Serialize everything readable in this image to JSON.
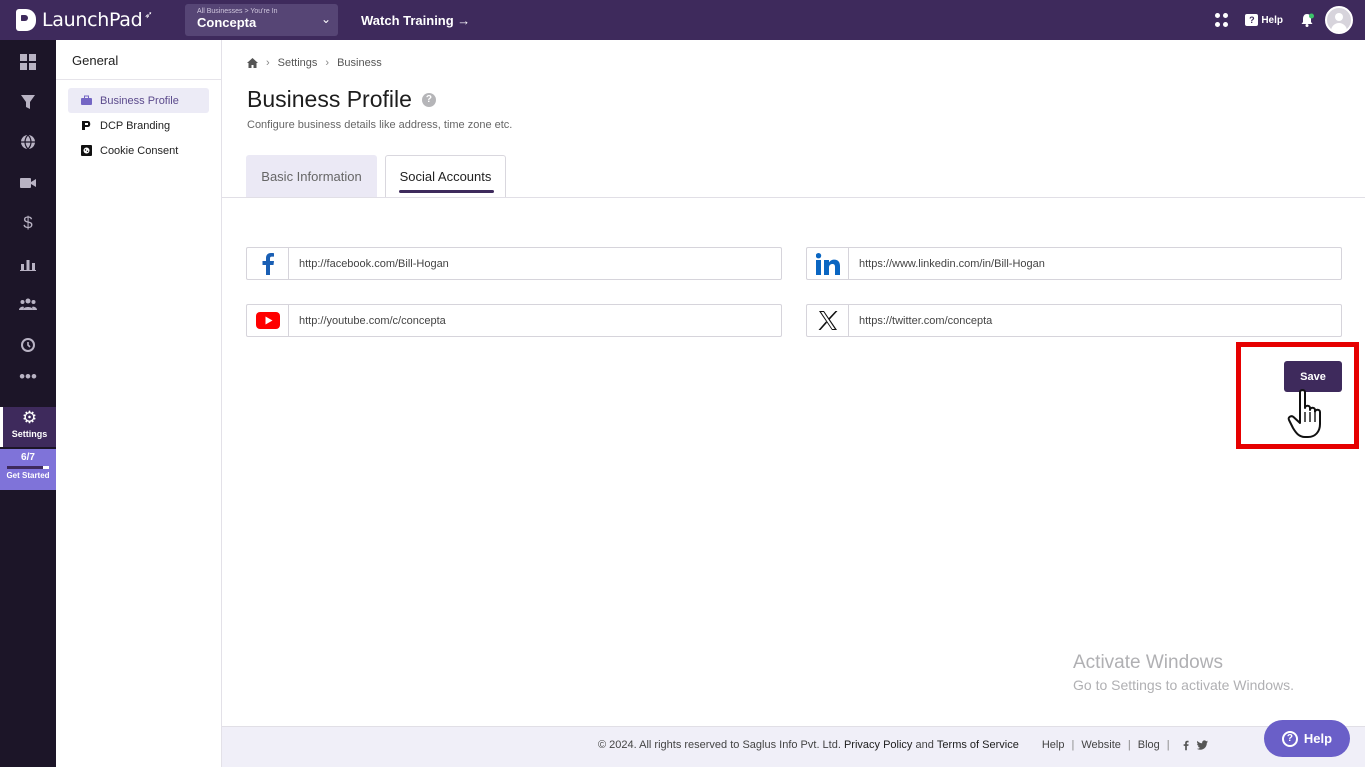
{
  "app": {
    "name": "LaunchPad"
  },
  "topbar": {
    "business_crumb": "All Businesses > You're In",
    "business_name": "Concepta",
    "watch_training": "Watch Training →",
    "help_label": "Help"
  },
  "rail": {
    "items": [
      "dashboard-icon",
      "funnel-icon",
      "globe-icon",
      "video-icon",
      "dollar-icon",
      "analytics-icon",
      "users-icon",
      "history-icon",
      "more-icon"
    ],
    "settings_label": "Settings",
    "progress_count": "6/7",
    "progress_fraction": 0.857,
    "get_started_label": "Get Started"
  },
  "settings_nav": {
    "heading": "General",
    "items": [
      {
        "label": "Business Profile",
        "active": true
      },
      {
        "label": "DCP Branding",
        "active": false
      },
      {
        "label": "Cookie Consent",
        "active": false
      }
    ]
  },
  "breadcrumb": {
    "settings": "Settings",
    "business": "Business"
  },
  "page": {
    "title": "Business Profile",
    "help_glyph": "?",
    "subtitle": "Configure business details like address, time zone etc."
  },
  "tabs": [
    {
      "label": "Basic Information",
      "active": false
    },
    {
      "label": "Social Accounts",
      "active": true
    }
  ],
  "social": {
    "facebook": "http://facebook.com/Bill-Hogan",
    "linkedin": "https://www.linkedin.com/in/Bill-Hogan",
    "youtube": "http://youtube.com/c/concepta",
    "twitter": "https://twitter.com/concepta"
  },
  "actions": {
    "save_label": "Save"
  },
  "watermark": {
    "line1": "Activate Windows",
    "line2": "Go to Settings to activate Windows."
  },
  "footer": {
    "copyright": "©  2024. All rights reserved to Saglus Info Pvt. Ltd.",
    "privacy": "Privacy Policy",
    "and": "and",
    "terms": "Terms of Service",
    "help": "Help",
    "website": "Website",
    "blog": "Blog"
  },
  "help_fab": {
    "label": "Help"
  },
  "colors": {
    "brand": "#3e2a5c",
    "accent": "#6a5fc8",
    "highlight_box": "#e60000"
  }
}
